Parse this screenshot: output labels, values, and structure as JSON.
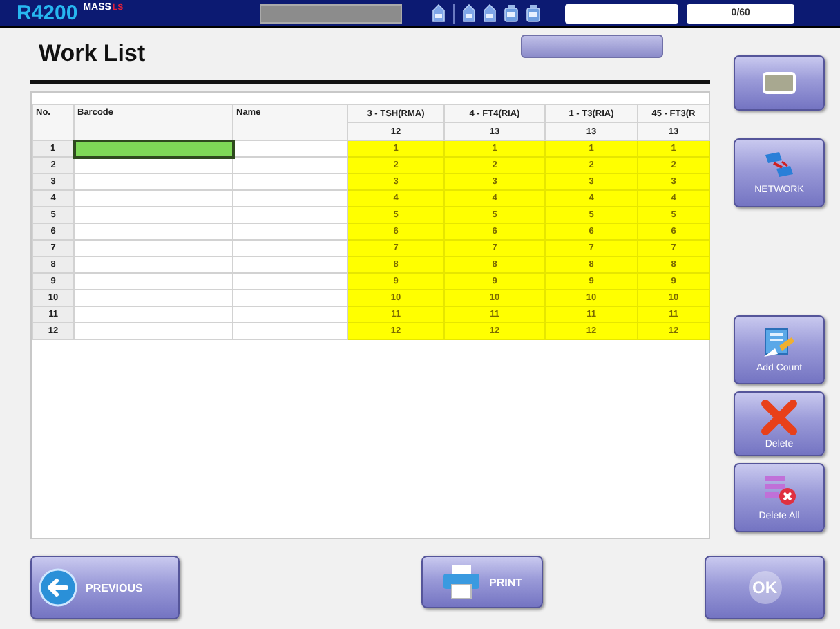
{
  "header": {
    "model": "R4200",
    "edition": "MASS",
    "edition_suffix": "LS",
    "counter": "0/60"
  },
  "title": "Work List",
  "table": {
    "columns": [
      {
        "label": "No.",
        "kind": "index"
      },
      {
        "label": "Barcode",
        "kind": "text"
      },
      {
        "label": "Name",
        "kind": "text"
      },
      {
        "label": "3 - TSH(RMA)",
        "kind": "test",
        "count": "12"
      },
      {
        "label": "4 - FT4(RIA)",
        "kind": "test",
        "count": "13"
      },
      {
        "label": "1 - T3(RIA)",
        "kind": "test",
        "count": "13"
      },
      {
        "label": "45 - FT3(R",
        "kind": "test",
        "count": "13"
      }
    ],
    "rows": [
      {
        "no": "1",
        "selected": true,
        "tests": [
          "1",
          "1",
          "1",
          "1"
        ]
      },
      {
        "no": "2",
        "selected": false,
        "tests": [
          "2",
          "2",
          "2",
          "2"
        ]
      },
      {
        "no": "3",
        "selected": false,
        "tests": [
          "3",
          "3",
          "3",
          "3"
        ]
      },
      {
        "no": "4",
        "selected": false,
        "tests": [
          "4",
          "4",
          "4",
          "4"
        ]
      },
      {
        "no": "5",
        "selected": false,
        "tests": [
          "5",
          "5",
          "5",
          "5"
        ]
      },
      {
        "no": "6",
        "selected": false,
        "tests": [
          "6",
          "6",
          "6",
          "6"
        ]
      },
      {
        "no": "7",
        "selected": false,
        "tests": [
          "7",
          "7",
          "7",
          "7"
        ]
      },
      {
        "no": "8",
        "selected": false,
        "tests": [
          "8",
          "8",
          "8",
          "8"
        ]
      },
      {
        "no": "9",
        "selected": false,
        "tests": [
          "9",
          "9",
          "9",
          "9"
        ]
      },
      {
        "no": "10",
        "selected": false,
        "tests": [
          "10",
          "10",
          "10",
          "10"
        ]
      },
      {
        "no": "11",
        "selected": false,
        "tests": [
          "11",
          "11",
          "11",
          "11"
        ]
      },
      {
        "no": "12",
        "selected": false,
        "tests": [
          "12",
          "12",
          "12",
          "12"
        ]
      }
    ]
  },
  "side_buttons": [
    {
      "kind": "card"
    },
    {
      "kind": "network",
      "label": "NETWORK"
    },
    {
      "kind": "add",
      "label": "Add Count"
    },
    {
      "kind": "delete",
      "label": "Delete"
    },
    {
      "kind": "delete_all",
      "label": "Delete All"
    }
  ],
  "bottom_buttons": [
    {
      "kind": "previous",
      "label": "PREVIOUS"
    },
    {
      "kind": "print",
      "label": "PRINT"
    },
    {
      "kind": "ok",
      "label": "OK"
    }
  ]
}
